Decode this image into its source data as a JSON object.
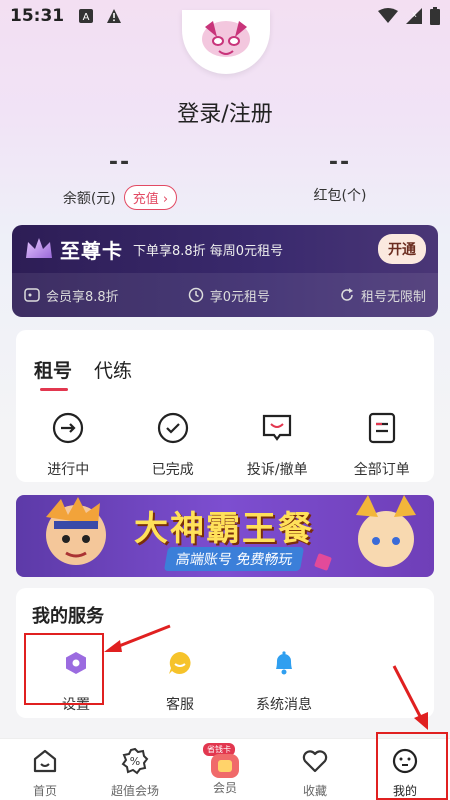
{
  "status_bar": {
    "time": "15:31"
  },
  "profile": {
    "login_title": "登录/注册"
  },
  "stats": {
    "balance": {
      "value": "--",
      "label": "余额(元)",
      "action": "充值"
    },
    "redpacket": {
      "value": "--",
      "label": "红包(个)"
    }
  },
  "vip": {
    "title": "至尊卡",
    "desc": "下单享8.8折 每周0元租号",
    "open_button": "开通",
    "benefits": [
      "会员享8.8折",
      "享0元租号",
      "租号无限制"
    ]
  },
  "orders": {
    "tabs": [
      "租号",
      "代练"
    ],
    "items": [
      "进行中",
      "已完成",
      "投诉/撤单",
      "全部订单"
    ]
  },
  "banner": {
    "title": "大神霸王餐",
    "subtitle": "高端账号 免费畅玩"
  },
  "services": {
    "title": "我的服务",
    "items": [
      "设置",
      "客服",
      "系统消息"
    ]
  },
  "tabbar": {
    "items": [
      "首页",
      "超值会场",
      "会员",
      "收藏",
      "我的"
    ],
    "vip_badge": "省钱卡"
  },
  "colors": {
    "accent": "#e2374f",
    "vip_bg": "#2d1d55",
    "highlight": "#e02020"
  }
}
